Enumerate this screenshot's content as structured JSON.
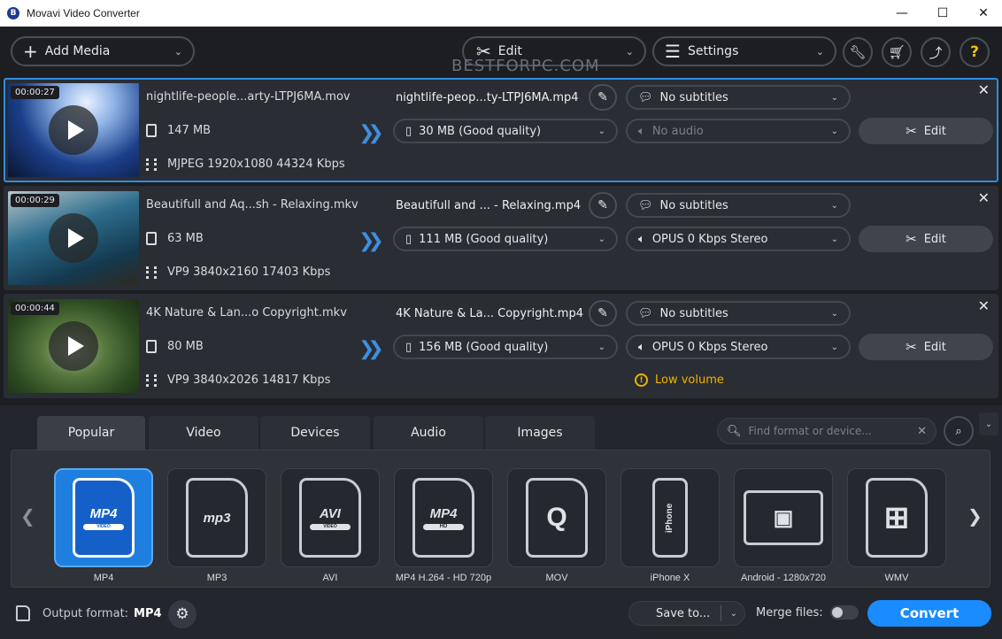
{
  "window": {
    "title": "Movavi Video Converter",
    "app_icon_glyph": "B",
    "minimize": "—",
    "maximize": "☐",
    "close": "✕"
  },
  "toolbar": {
    "add_media": "Add Media",
    "edit": "Edit",
    "settings": "Settings",
    "help": "?",
    "watermark": "BESTFORPC.COM"
  },
  "files": [
    {
      "duration": "00:00:27",
      "source_name": "nightlife-people...arty-LTPJ6MA.mov",
      "source_size": "147 MB",
      "source_meta": "MJPEG 1920x1080 44324 Kbps",
      "output_name": "nightlife-peop...ty-LTPJ6MA.mp4",
      "subtitles": "No subtitles",
      "output_size": "30 MB (Good quality)",
      "audio": "No audio",
      "audio_disabled": true,
      "edit_label": "Edit",
      "warning": ""
    },
    {
      "duration": "00:00:29",
      "source_name": "Beautifull and Aq...sh - Relaxing.mkv",
      "source_size": "63 MB",
      "source_meta": "VP9 3840x2160 17403 Kbps",
      "output_name": "Beautifull and ... - Relaxing.mp4",
      "subtitles": "No subtitles",
      "output_size": "111 MB (Good quality)",
      "audio": "OPUS 0 Kbps Stereo",
      "audio_disabled": false,
      "edit_label": "Edit",
      "warning": ""
    },
    {
      "duration": "00:00:44",
      "source_name": "4K Nature & Lan...o Copyright.mkv",
      "source_size": "80 MB",
      "source_meta": "VP9 3840x2026 14817 Kbps",
      "output_name": "4K Nature & La... Copyright.mp4",
      "subtitles": "No subtitles",
      "output_size": "156 MB (Good quality)",
      "audio": "OPUS 0 Kbps Stereo",
      "audio_disabled": false,
      "edit_label": "Edit",
      "warning": "Low volume"
    }
  ],
  "format_tabs": [
    "Popular",
    "Video",
    "Devices",
    "Audio",
    "Images"
  ],
  "active_tab": "Popular",
  "search": {
    "placeholder": "Find format or device..."
  },
  "presets": [
    {
      "label": "MP4",
      "card_text": "MP4",
      "band": "VIDEO",
      "selected": true
    },
    {
      "label": "MP3",
      "card_text": "mp3",
      "band": "",
      "selected": false
    },
    {
      "label": "AVI",
      "card_text": "AVI",
      "band": "VIDEO",
      "selected": false
    },
    {
      "label": "MP4 H.264 - HD 720p",
      "card_text": "MP4",
      "band": "HD",
      "selected": false
    },
    {
      "label": "MOV",
      "card_text": "Q",
      "band": "",
      "selected": false
    },
    {
      "label": "iPhone X",
      "card_text": "iPhone",
      "band": "",
      "selected": false
    },
    {
      "label": "Android - 1280x720",
      "card_text": "▣",
      "band": "",
      "selected": false
    },
    {
      "label": "WMV",
      "card_text": "⊞",
      "band": "",
      "selected": false
    }
  ],
  "bottom": {
    "output_format_label": "Output format:",
    "output_format_value": "MP4",
    "save_to": "Save to...",
    "merge_files": "Merge files:",
    "merge_enabled": false,
    "convert": "Convert"
  },
  "colors": {
    "accent": "#1a8cff",
    "selected_border": "#2f8ce0",
    "warning": "#f0b400",
    "help": "#f3c300"
  }
}
